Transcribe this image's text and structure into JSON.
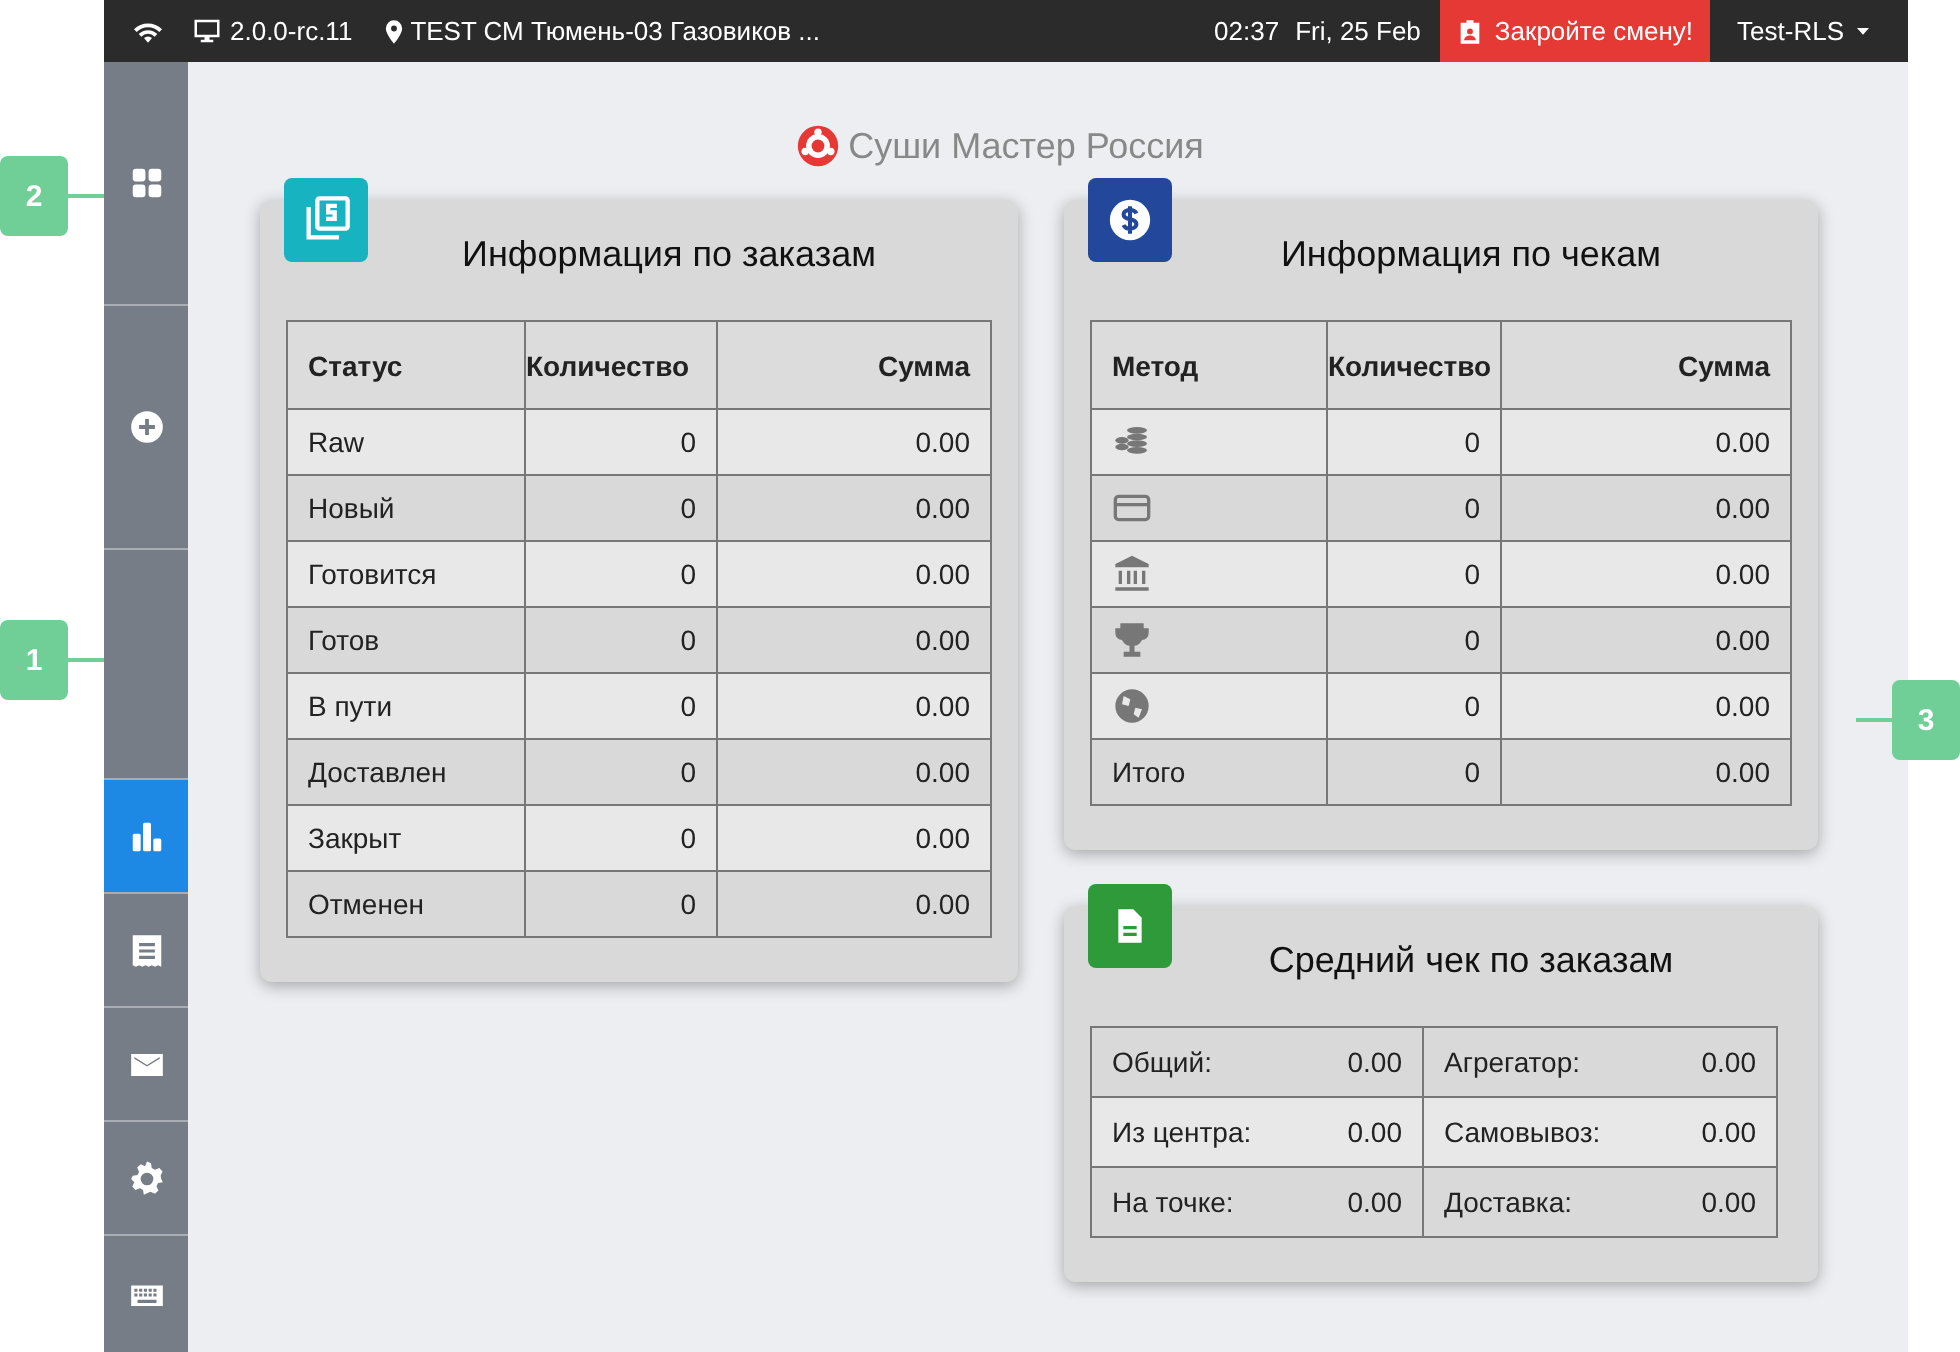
{
  "top_bar": {
    "version": "2.0.0-rc.11",
    "location": "TEST СМ Тюмень-03 Газовиков ...",
    "time": "02:37",
    "date": "Fri, 25 Feb",
    "alert_button": "Закройте смену!",
    "user": "Test-RLS"
  },
  "sidebar": {
    "items": [
      {
        "kind": "dashboard",
        "selected": false
      },
      {
        "kind": "new",
        "selected": false
      },
      {
        "kind": "blank",
        "selected": false
      },
      {
        "kind": "stats",
        "selected": true
      },
      {
        "kind": "receipts",
        "selected": false
      },
      {
        "kind": "messages",
        "selected": false
      },
      {
        "kind": "settings",
        "selected": false
      },
      {
        "kind": "keyboard",
        "selected": false
      }
    ]
  },
  "callouts": [
    {
      "label": "2"
    },
    {
      "label": "1"
    },
    {
      "label": "3"
    }
  ],
  "brand": "Суши Мастер Россия",
  "orders_card": {
    "title": "Информация по заказам",
    "columns": [
      "Статус",
      "Количество",
      "Сумма"
    ],
    "rows": [
      [
        "Raw",
        "0",
        "0.00"
      ],
      [
        "Новый",
        "0",
        "0.00"
      ],
      [
        "Готовится",
        "0",
        "0.00"
      ],
      [
        "Готов",
        "0",
        "0.00"
      ],
      [
        "В пути",
        "0",
        "0.00"
      ],
      [
        "Доставлен",
        "0",
        "0.00"
      ],
      [
        "Закрыт",
        "0",
        "0.00"
      ],
      [
        "Отменен",
        "0",
        "0.00"
      ]
    ]
  },
  "checks_card": {
    "title": "Информация по чекам",
    "columns": [
      "Метод",
      "Количество",
      "Сумма"
    ],
    "rows": [
      {
        "kind": "cash",
        "count": "0",
        "sum": "0.00"
      },
      {
        "kind": "card",
        "count": "0",
        "sum": "0.00"
      },
      {
        "kind": "bank",
        "count": "0",
        "sum": "0.00"
      },
      {
        "kind": "bonus",
        "count": "0",
        "sum": "0.00"
      },
      {
        "kind": "online",
        "count": "0",
        "sum": "0.00"
      },
      {
        "kind": "total",
        "label": "Итого",
        "count": "0",
        "sum": "0.00"
      }
    ]
  },
  "average_card": {
    "title": "Средний чек по заказам",
    "rows": [
      [
        {
          "label": "Общий:",
          "value": "0.00"
        },
        {
          "label": "Агрегатор:",
          "value": "0.00"
        }
      ],
      [
        {
          "label": "Из центра:",
          "value": "0.00"
        },
        {
          "label": "Самовывоз:",
          "value": "0.00"
        }
      ],
      [
        {
          "label": "На точке:",
          "value": "0.00"
        },
        {
          "label": "Доставка:",
          "value": "0.00"
        }
      ]
    ]
  }
}
